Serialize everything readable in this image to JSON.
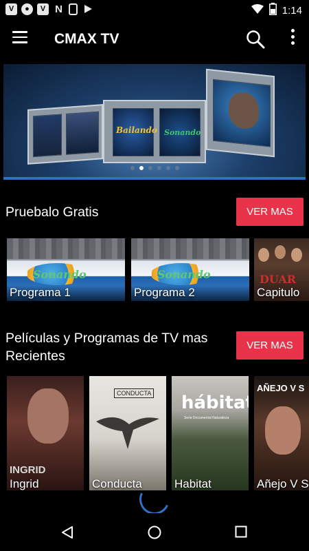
{
  "status_bar": {
    "time": "1:14",
    "left_icons": [
      "vine-icon",
      "account-circle-icon",
      "vine-icon",
      "n-icon",
      "vine-icon",
      "download-icon"
    ],
    "right_icons": [
      "wifi-icon",
      "battery-charging-icon"
    ]
  },
  "app_bar": {
    "title": "CMAX TV",
    "menu_icon": "menu-icon",
    "search_icon": "search-icon",
    "more_icon": "more-vert-icon"
  },
  "banner": {
    "logo_texts": [
      "Bailando",
      "Sonando"
    ],
    "dots": 6,
    "active_dot": 1,
    "accent_line_color": "#2f6fc4"
  },
  "sections": [
    {
      "title": "Pruebalo Gratis",
      "button_label": "VER MAS",
      "items": [
        {
          "title": "Programa 1",
          "logo": "Sonando"
        },
        {
          "title": "Programa 2",
          "logo": "Sonando"
        },
        {
          "title": "Capitulo",
          "poster_text": "DUAR"
        }
      ]
    },
    {
      "title": "Películas y Programas de TV mas Recientes",
      "button_label": "VER MAS",
      "items": [
        {
          "title": "Ingrid",
          "poster_text": "INGRID"
        },
        {
          "title": "Conducta",
          "poster_text": "CONDUCTA"
        },
        {
          "title": "Habitat",
          "poster_text": "hábitat",
          "poster_subtext": "Serie Documental Naturaleza"
        },
        {
          "title": "Añejo V S",
          "poster_text": "AÑEJO V S"
        }
      ]
    }
  ],
  "colors": {
    "accent_button": "#e8344a",
    "background": "#000000",
    "spinner": "#2e72c9"
  },
  "nav": [
    "back-icon",
    "home-icon",
    "recents-icon"
  ]
}
